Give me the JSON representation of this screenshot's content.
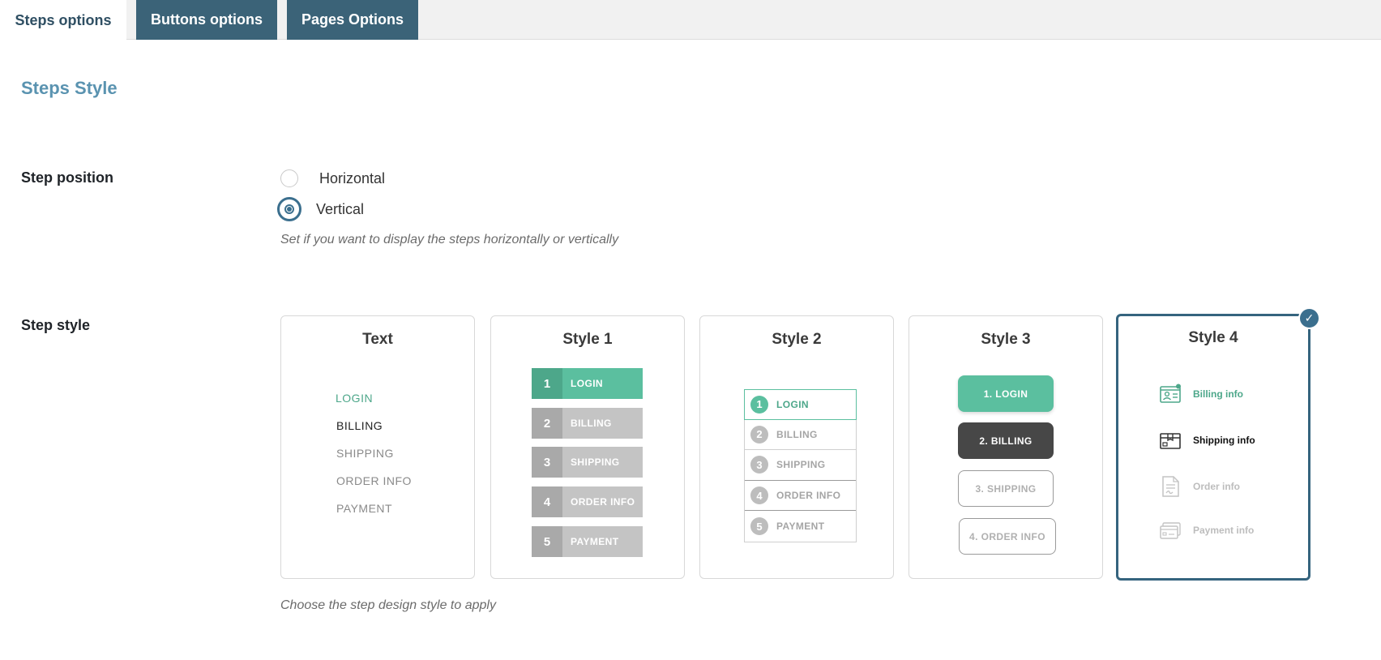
{
  "tabs": [
    {
      "label": "Steps options"
    },
    {
      "label": "Buttons options"
    },
    {
      "label": "Pages Options"
    }
  ],
  "section_title": "Steps Style",
  "step_position": {
    "label": "Step position",
    "options": [
      {
        "label": "Horizontal",
        "checked": false
      },
      {
        "label": "Vertical",
        "checked": true
      }
    ],
    "hint": "Set if you want to display the steps horizontally or vertically"
  },
  "step_style": {
    "label": "Step style",
    "hint": "Choose the step design style to apply",
    "selected": "Style 4",
    "cards": [
      {
        "title": "Text",
        "items": [
          "LOGIN",
          "BILLING",
          "SHIPPING",
          "ORDER INFO",
          "PAYMENT"
        ]
      },
      {
        "title": "Style 1",
        "items": [
          {
            "num": "1",
            "label": "LOGIN"
          },
          {
            "num": "2",
            "label": "BILLING"
          },
          {
            "num": "3",
            "label": "SHIPPING"
          },
          {
            "num": "4",
            "label": "ORDER INFO"
          },
          {
            "num": "5",
            "label": "PAYMENT"
          }
        ]
      },
      {
        "title": "Style 2",
        "items": [
          {
            "num": "1",
            "label": "LOGIN"
          },
          {
            "num": "2",
            "label": "BILLING"
          },
          {
            "num": "3",
            "label": "SHIPPING"
          },
          {
            "num": "4",
            "label": "ORDER INFO"
          },
          {
            "num": "5",
            "label": "PAYMENT"
          }
        ]
      },
      {
        "title": "Style 3",
        "items": [
          "1. LOGIN",
          "2. BILLING",
          "3. SHIPPING",
          "4. ORDER INFO"
        ]
      },
      {
        "title": "Style 4",
        "items": [
          {
            "label": "Billing info",
            "icon": "billing-card-icon"
          },
          {
            "label": "Shipping info",
            "icon": "shipping-box-icon"
          },
          {
            "label": "Order info",
            "icon": "order-document-icon"
          },
          {
            "label": "Payment info",
            "icon": "payment-card-icon"
          }
        ]
      }
    ]
  },
  "colors": {
    "accent": "#3b6f8e",
    "tab_inactive": "#3b6378",
    "green": "#5bbf9f",
    "green_dark": "#4da78a",
    "grey": "#c4c4c4",
    "grey_dark": "#a9a9a9",
    "dark_button": "#474747"
  }
}
